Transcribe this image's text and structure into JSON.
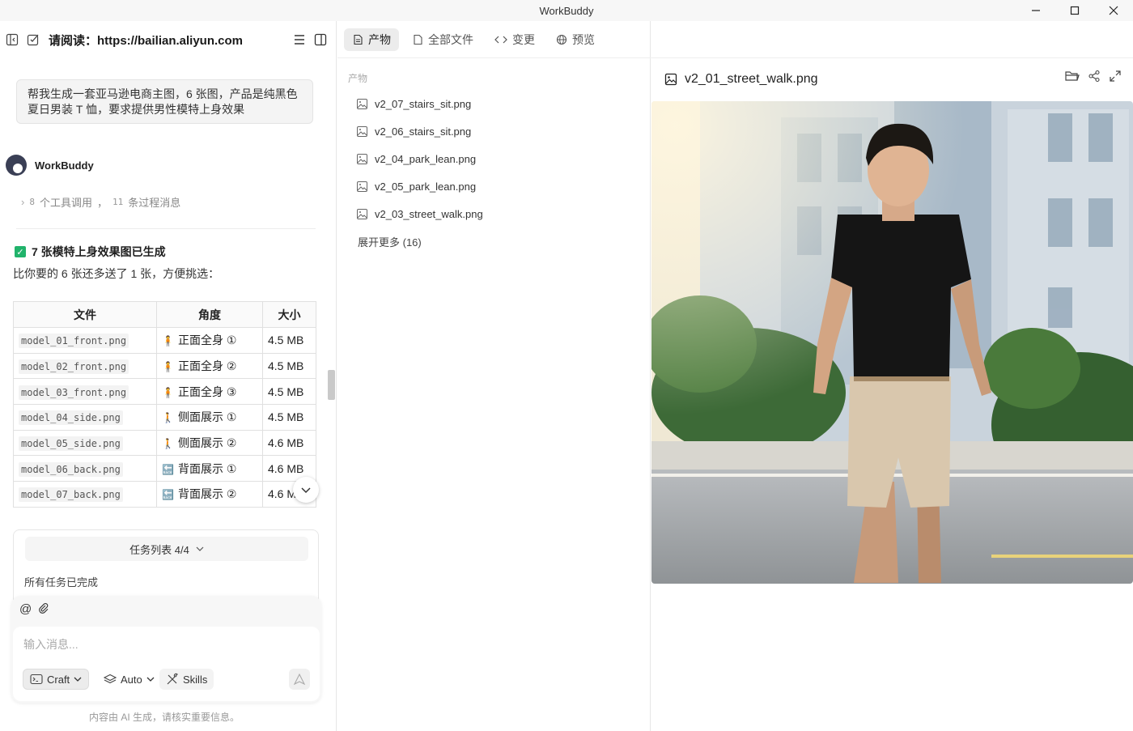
{
  "window": {
    "title": "WorkBuddy"
  },
  "left": {
    "title": "请阅读：https://bailian.aliyun.com",
    "user_message": "帮我生成一套亚马逊电商主图，6 张图，产品是纯黑色夏日男装 T 恤，要求提供男性模特上身效果",
    "bot_name": "WorkBuddy",
    "tools_summary": {
      "tool_count": "8",
      "tool_text": "个工具调用",
      "sep": "，",
      "process_count": "11",
      "process_text": "条过程消息"
    },
    "done_title": "7 张模特上身效果图已生成",
    "done_sub": "比你要的 6 张还多送了 1 张，方便挑选：",
    "table": {
      "headers": [
        "文件",
        "角度",
        "大小"
      ],
      "rows": [
        {
          "file": "model_01_front.png",
          "icon": "🧍",
          "angle": "正面全身 ①",
          "size": "4.5 MB"
        },
        {
          "file": "model_02_front.png",
          "icon": "🧍",
          "angle": "正面全身 ②",
          "size": "4.5 MB"
        },
        {
          "file": "model_03_front.png",
          "icon": "🧍",
          "angle": "正面全身 ③",
          "size": "4.5 MB"
        },
        {
          "file": "model_04_side.png",
          "icon": "🚶",
          "angle": "侧面展示 ①",
          "size": "4.5 MB"
        },
        {
          "file": "model_05_side.png",
          "icon": "🚶",
          "angle": "侧面展示 ②",
          "size": "4.6 MB"
        },
        {
          "file": "model_06_back.png",
          "icon": "🔙",
          "angle": "背面展示 ①",
          "size": "4.6 MB"
        },
        {
          "file": "model_07_back.png",
          "icon": "🔙",
          "angle": "背面展示 ②",
          "size": "4.6 MB"
        }
      ]
    },
    "task": {
      "label": "任务列表 4/4",
      "status": "所有任务已完成"
    },
    "input": {
      "placeholder": "输入消息...",
      "craft": "Craft",
      "auto": "Auto",
      "skills": "Skills"
    },
    "disclaimer": "内容由 AI 生成，请核实重要信息。"
  },
  "tabs": [
    {
      "label": "产物",
      "icon": "document-icon"
    },
    {
      "label": "全部文件",
      "icon": "file-icon"
    },
    {
      "label": "变更",
      "icon": "code-icon"
    },
    {
      "label": "预览",
      "icon": "globe-icon"
    }
  ],
  "middle": {
    "section_label": "产物",
    "files": [
      "v2_07_stairs_sit.png",
      "v2_06_stairs_sit.png",
      "v2_04_park_lean.png",
      "v2_05_park_lean.png",
      "v2_03_street_walk.png"
    ],
    "expand_more": "展开更多 (16)"
  },
  "preview": {
    "filename": "v2_01_street_walk.png"
  },
  "colors": {
    "accent_green": "#21b36b",
    "tab_active_bg": "#ececec"
  }
}
